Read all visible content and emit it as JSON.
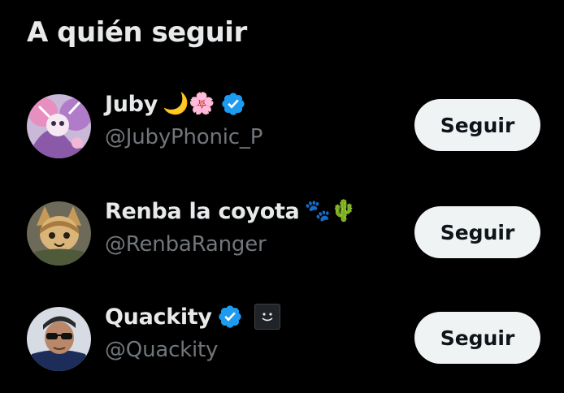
{
  "panel": {
    "title": "A quién seguir"
  },
  "colors": {
    "background": "#000000",
    "text_primary": "#e7e9ea",
    "text_secondary": "#71767b",
    "button_bg": "#eff3f4",
    "button_text": "#0f1419",
    "verified": "#1d9bf0"
  },
  "suggestions": [
    {
      "name": "Juby",
      "emoji": "🌙🌸",
      "verified": true,
      "handle": "@JubyPhonic_P",
      "follow_label": "Seguir",
      "avatar_icon": "juby-avatar"
    },
    {
      "name": "Renba la coyota",
      "emoji": "🐾🌵",
      "verified": false,
      "handle": "@RenbaRanger",
      "follow_label": "Seguir",
      "avatar_icon": "renba-avatar"
    },
    {
      "name": "Quackity",
      "emoji": "",
      "verified": true,
      "affiliate_badge": "smiley-badge-icon",
      "handle": "@Quackity",
      "follow_label": "Seguir",
      "avatar_icon": "quackity-avatar"
    }
  ]
}
